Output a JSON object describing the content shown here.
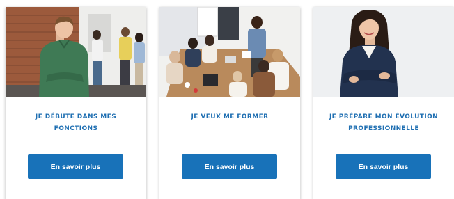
{
  "colors": {
    "accent": "#1f6fb2",
    "button": "#1872b9",
    "button_text": "#ffffff"
  },
  "cards": [
    {
      "image": "man-in-green-shirt-office-photo",
      "title_line1": "JE DÉBUTE DANS MES",
      "title_line2": "FONCTIONS",
      "button_label": "En savoir plus"
    },
    {
      "image": "team-meeting-around-table-photo",
      "title_line1": "JE VEUX ME FORMER",
      "title_line2": "",
      "button_label": "En savoir plus"
    },
    {
      "image": "businesswoman-arms-crossed-photo",
      "title_line1": "JE PRÉPARE MON ÉVOLUTION",
      "title_line2": "PROFESSIONNELLE",
      "button_label": "En savoir plus"
    }
  ]
}
